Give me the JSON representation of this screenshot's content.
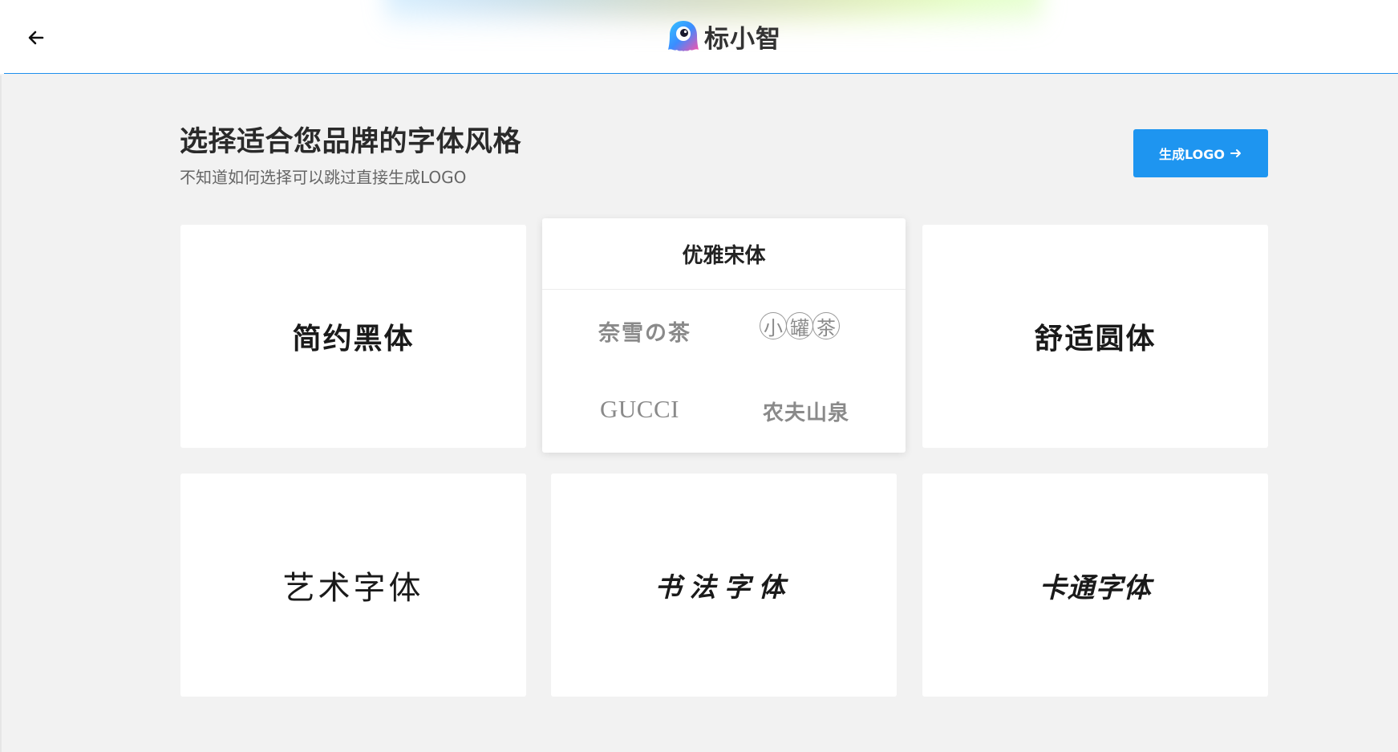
{
  "header": {
    "back_icon": "arrow-left-icon",
    "brand_icon": "mascot-logo-icon",
    "brand_name": "标小智",
    "accent_color": "#1e90ee"
  },
  "main": {
    "title": "选择适合您品牌的字体风格",
    "subtitle": "不知道如何选择可以跳过直接生成LOGO",
    "generate_button": {
      "label": "生成LOGO",
      "icon": "arrow-right-icon",
      "color": "#1e95f0"
    },
    "font_styles": [
      {
        "label": "简约黑体"
      },
      {
        "label": "优雅宋体",
        "samples": [
          "奈雪の茶",
          "小",
          "罐",
          "茶",
          "GUCCI",
          "农夫山泉"
        ]
      },
      {
        "label": "舒适圆体"
      },
      {
        "label": "艺术字体"
      },
      {
        "label": "书法字体"
      },
      {
        "label": "卡通字体"
      }
    ]
  }
}
